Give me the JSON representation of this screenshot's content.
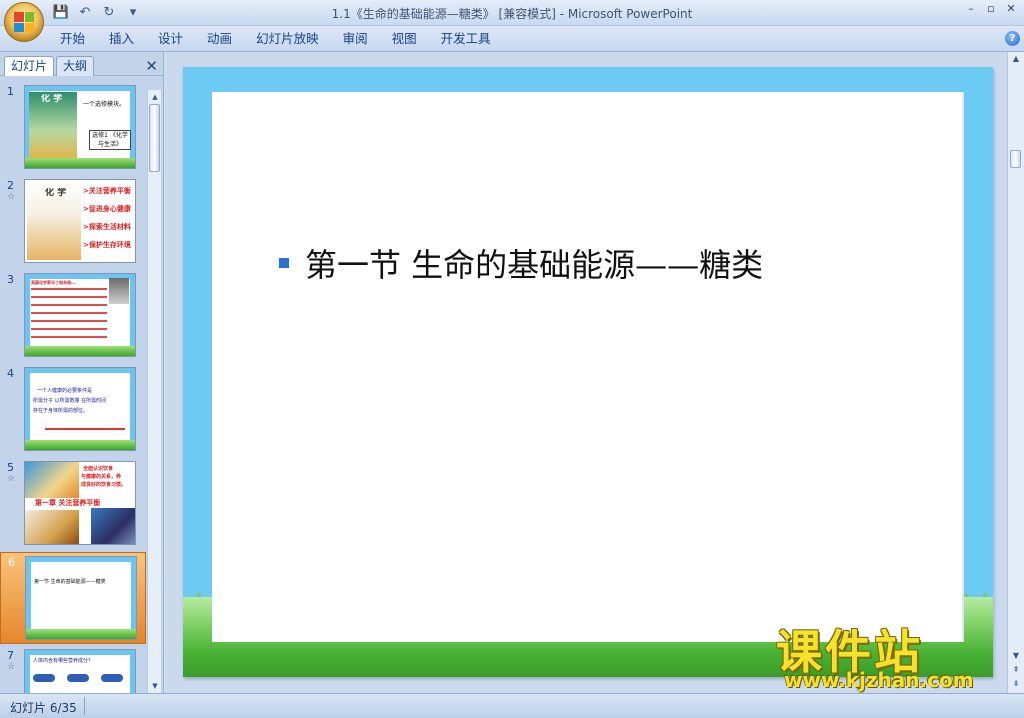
{
  "window": {
    "title": "1.1《生命的基础能源—糖类》 [兼容模式] - Microsoft PowerPoint",
    "min": "–",
    "max": "▫",
    "close": "✕"
  },
  "qat": {
    "save": "💾",
    "undo": "↶",
    "redo": "↻",
    "customize": "▾"
  },
  "ribbon": {
    "tabs": [
      "开始",
      "插入",
      "设计",
      "动画",
      "幻灯片放映",
      "审阅",
      "视图",
      "开发工具"
    ],
    "help": "?"
  },
  "left_pane": {
    "tabs": [
      "幻灯片",
      "大纲"
    ],
    "close": "✕",
    "slides": [
      {
        "num": "1",
        "anim": "",
        "texts": [
          "化 学",
          "一个选修模块。",
          "选修1",
          "《化学与生活》"
        ]
      },
      {
        "num": "2",
        "anim": "☆",
        "texts": [
          "化 学",
          ">关注营养平衡",
          ">促进身心健康",
          ">探索生活材料",
          ">保护生存环境"
        ]
      },
      {
        "num": "3",
        "anim": "",
        "texts": [
          "英国化学家马丁和辛格..."
        ]
      },
      {
        "num": "4",
        "anim": "",
        "texts": [
          "一个人健康的必要条件是",
          "所需分子 以所需数量 在所需时间",
          "存在于身体所需的部位。"
        ]
      },
      {
        "num": "5",
        "anim": "☆",
        "texts": [
          "全面认识饮食",
          "与健康的关系，养",
          "成良好的饮食习惯。",
          "第一章 关注营养平衡"
        ]
      },
      {
        "num": "6",
        "anim": "",
        "texts": [
          "第一节 生命的基础能源——糖类"
        ]
      },
      {
        "num": "7",
        "anim": "☆",
        "texts": [
          "人体内含有哪些营养成分？"
        ]
      }
    ]
  },
  "slide": {
    "title": "第一节 生命的基础能源——糖类"
  },
  "watermark": {
    "big": "课件站",
    "small": "www.kjzhan.com"
  },
  "status": {
    "slide_counter": "幻灯片 6/35"
  },
  "colors": {
    "accent": "#2a72d0",
    "sky": "#6ccaf3",
    "selected": "#e6862c"
  }
}
